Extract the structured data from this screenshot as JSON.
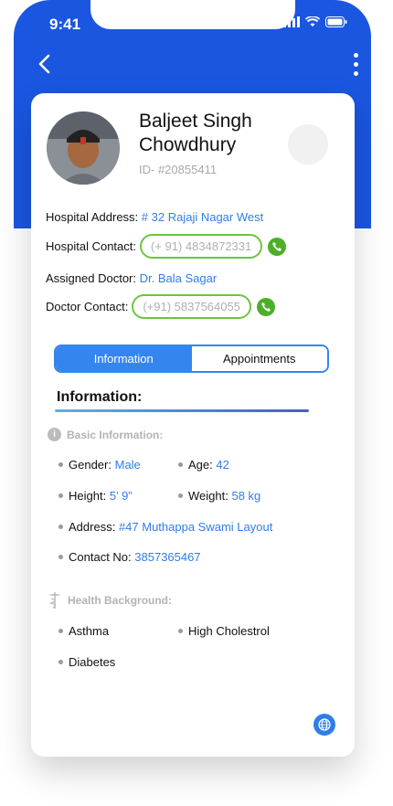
{
  "status": {
    "time": "9:41"
  },
  "profile": {
    "name": "Baljeet Singh Chowdhury",
    "id": "ID- #20855411"
  },
  "details": {
    "hospital_address_label": "Hospital Address:",
    "hospital_address_value": "# 32 Rajaji Nagar West",
    "hospital_contact_label": "Hospital Contact:",
    "hospital_contact_value": "(+ 91) 4834872331",
    "assigned_doctor_label": "Assigned Doctor:",
    "assigned_doctor_value": "Dr. Bala Sagar",
    "doctor_contact_label": "Doctor Contact:",
    "doctor_contact_value": "(+91) 5837564055"
  },
  "tabs": [
    {
      "label": "Information",
      "active": true
    },
    {
      "label": "Appointments",
      "active": false
    }
  ],
  "section": {
    "title": "Information:"
  },
  "basic": {
    "heading": "Basic Information:",
    "gender_label": "Gender:",
    "gender_value": "Male",
    "age_label": "Age:",
    "age_value": "42",
    "height_label": "Height:",
    "height_value": "5’ 9”",
    "weight_label": "Weight:",
    "weight_value": "58 kg",
    "address_label": "Address:",
    "address_value": "#47 Muthappa Swami Layout",
    "contact_label": "Contact No:",
    "contact_value": "3857365467"
  },
  "health": {
    "heading": "Health Background:",
    "items": [
      "Asthma",
      "High Cholestrol",
      "Diabetes"
    ]
  },
  "colors": {
    "primary": "#1a56e0",
    "accent": "#2f7ee8",
    "green": "#4caf28"
  }
}
